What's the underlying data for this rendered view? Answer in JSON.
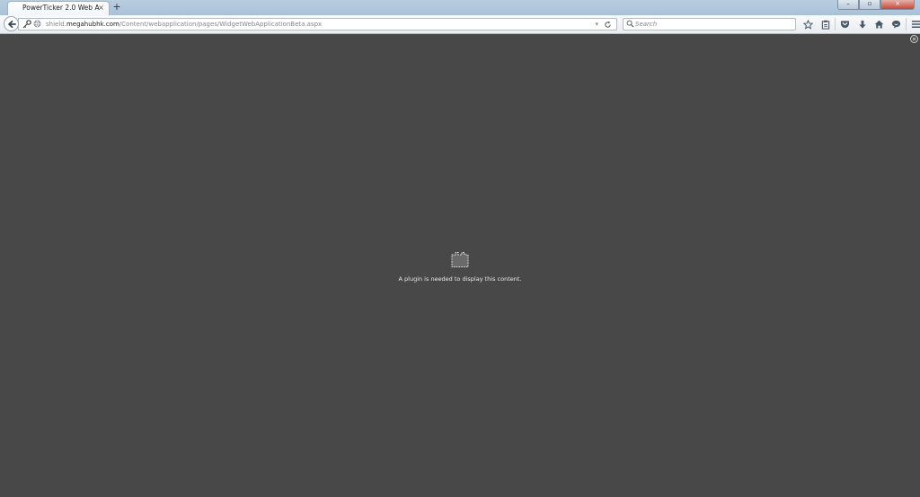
{
  "tab": {
    "title": "PowerTicker 2.0 Web Ap...",
    "close_glyph": "×",
    "new_tab_glyph": "+"
  },
  "window": {
    "minimize_glyph": "–",
    "maximize_glyph": "▫",
    "close_glyph": "×"
  },
  "nav": {
    "url_prefix": "shield.",
    "url_domain": "megahubhk.com",
    "url_path": "/Content/webapplication/pages/WidgetWebApplicationBeta.aspx",
    "search_placeholder": "Search"
  },
  "content": {
    "plugin_message": "A plugin is needed to display this content."
  },
  "colors": {
    "page_background": "#484848",
    "titlebar": "#b9cde0",
    "toolbar_icon": "#4a5866"
  },
  "icons": {
    "back": "back-arrow-icon",
    "identity": "key-icon",
    "site": "globe-icon",
    "reload": "reload-icon",
    "search": "search-icon",
    "bookmark": "star-icon",
    "reading_list": "clipboard-icon",
    "pocket": "pocket-icon",
    "downloads": "download-icon",
    "home": "home-icon",
    "hello": "chat-icon",
    "menu": "hamburger-menu-icon",
    "plugin": "plugin-icon",
    "close": "close-circle-icon"
  }
}
